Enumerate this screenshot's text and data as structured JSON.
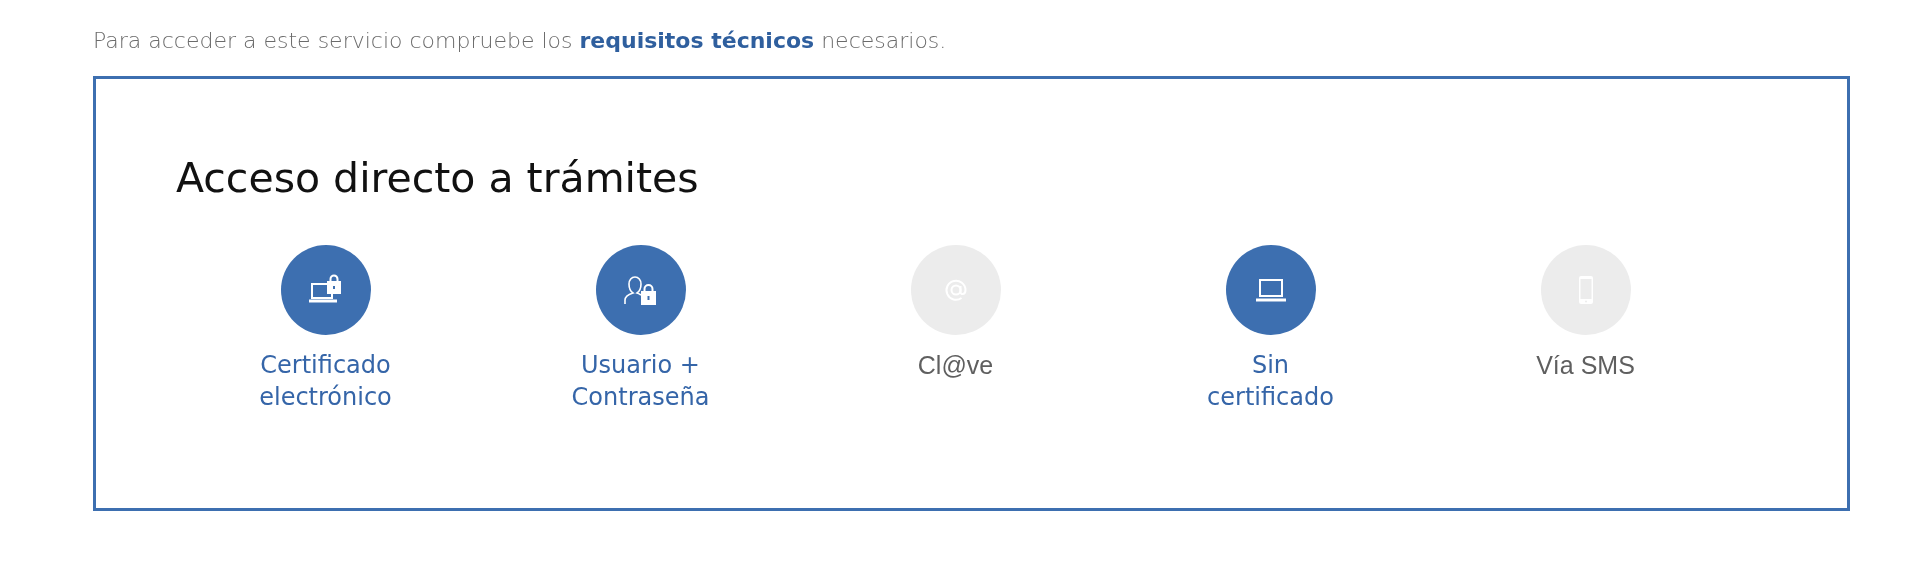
{
  "intro": {
    "text_before": "Para acceder a este servicio compruebe los",
    "link": "requisitos técnicos",
    "text_after": "necesarios."
  },
  "panel": {
    "title": "Acceso directo a trámites",
    "options": [
      {
        "kind": "certificate",
        "label_lines": [
          "Certificado",
          "electrónico"
        ],
        "disabled": false
      },
      {
        "kind": "user-lock",
        "label_lines": [
          "Usuario +",
          "Contraseña"
        ],
        "disabled": false
      },
      {
        "kind": "email",
        "label_lines": [
          "Cl@ve"
        ],
        "disabled": true
      },
      {
        "kind": "laptop",
        "label_lines": [
          "Sin",
          "certificado"
        ],
        "disabled": false
      },
      {
        "kind": "phone",
        "label_lines": [
          "Vía SMS"
        ],
        "disabled": true
      }
    ]
  }
}
